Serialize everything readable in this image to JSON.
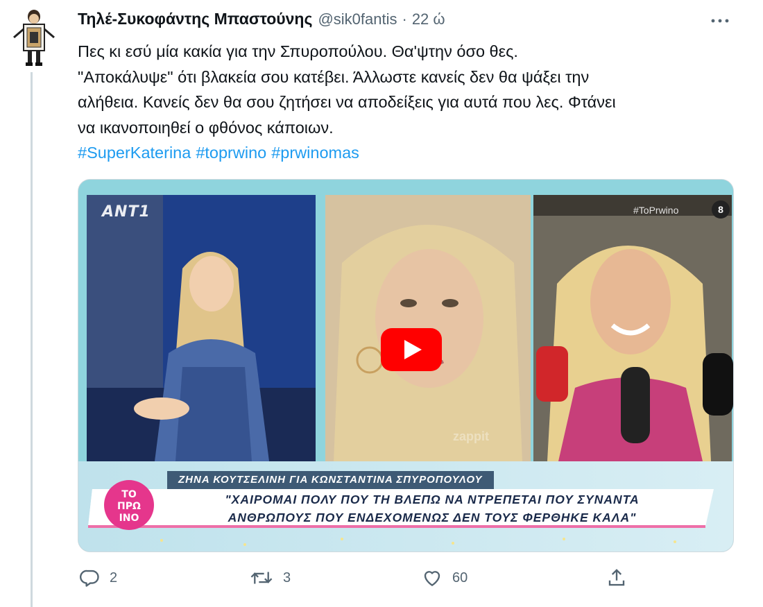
{
  "tweet": {
    "display_name": "Τηλέ-Συκοφάντης Μπαστούνης",
    "handle": "@sik0fantis",
    "separator": "·",
    "time": "22 ώ",
    "more_icon": "more-horizontal-icon",
    "text_lines": [
      "Πες κι εσύ μία κακία για την Σπυροπούλου. Θα'ψτην όσο θες.",
      "\"Αποκάλυψε\" ότι βλακεία σου κατέβει. Άλλωστε κανείς δεν θα ψάξει την",
      "αλήθεια. Κανείς δεν θα σου ζητήσει να αποδείξεις για αυτά που λες. Φτάνει",
      "να ικανοποιηθεί ο φθόνος κάποιων."
    ],
    "hashtags": [
      "#SuperKaterina",
      "#toprwino",
      "#prwinomas"
    ]
  },
  "media": {
    "play_icon": "youtube-play-icon",
    "channel_logo": "ANT1",
    "corner_tag": "#ToPrwino",
    "corner_num": "8",
    "watermark": "zappit",
    "show_logo_text": [
      "ΤΟ",
      "ΠΡΩ",
      "ΙΝΟ"
    ],
    "banner_name": "ΖΗΝΑ ΚΟΥΤΣΕΛΙΝΗ ΓΙΑ ΚΩΝΣΤΑΝΤΙΝΑ ΣΠΥΡΟΠΟΥΛΟΥ",
    "banner_quote_lines": [
      "\"ΧΑΙΡΟΜΑΙ ΠΟΛΥ ΠΟΥ ΤΗ ΒΛΕΠΩ ΝΑ ΝΤΡΕΠΕΤΑΙ ΠΟΥ ΣΥΝΑΝΤΑ",
      "ΑΝΘΡΩΠΟΥΣ ΠΟΥ ΕΝΔΕΧΟΜΕΝΩΣ ΔΕΝ ΤΟΥΣ ΦΕΡΘΗΚΕ ΚΑΛΑ\""
    ]
  },
  "actions": {
    "reply": {
      "icon": "reply-icon",
      "count": "2"
    },
    "retweet": {
      "icon": "retweet-icon",
      "count": "3"
    },
    "like": {
      "icon": "heart-icon",
      "count": "60"
    },
    "share": {
      "icon": "share-icon"
    }
  },
  "colors": {
    "link": "#1d9bf0",
    "secondary_text": "#536471",
    "youtube_red": "#ff0000",
    "frame_teal": "#8fd4dd"
  }
}
